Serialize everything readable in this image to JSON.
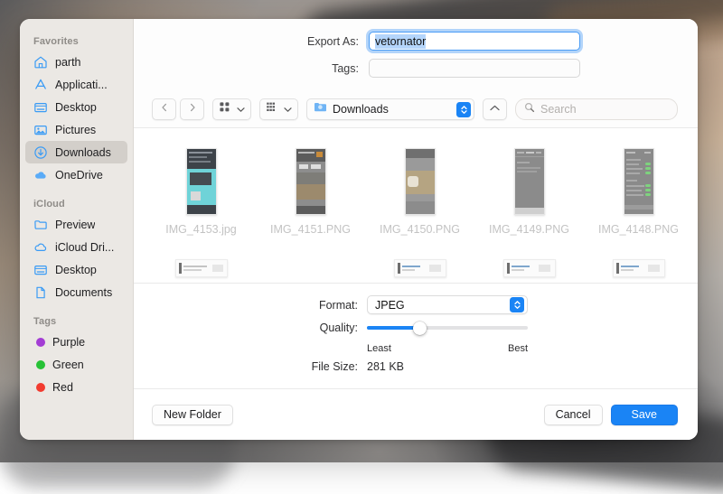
{
  "sidebar": {
    "sections": [
      {
        "title": "Favorites",
        "items": [
          {
            "label": "parth",
            "icon": "home-icon",
            "selected": false
          },
          {
            "label": "Applicati...",
            "icon": "applications-icon",
            "selected": false
          },
          {
            "label": "Desktop",
            "icon": "desktop-icon",
            "selected": false
          },
          {
            "label": "Pictures",
            "icon": "pictures-icon",
            "selected": false
          },
          {
            "label": "Downloads",
            "icon": "downloads-icon",
            "selected": true
          },
          {
            "label": "OneDrive",
            "icon": "cloud-icon",
            "selected": false
          }
        ]
      },
      {
        "title": "iCloud",
        "items": [
          {
            "label": "Preview",
            "icon": "folder-icon",
            "selected": false
          },
          {
            "label": "iCloud Dri...",
            "icon": "cloud-icon",
            "selected": false
          },
          {
            "label": "Desktop",
            "icon": "desktop-icon",
            "selected": false
          },
          {
            "label": "Documents",
            "icon": "document-icon",
            "selected": false
          }
        ]
      },
      {
        "title": "Tags",
        "items": [
          {
            "label": "Purple",
            "icon": "tag-dot-icon",
            "color": "#a33dd4",
            "selected": false
          },
          {
            "label": "Green",
            "icon": "tag-dot-icon",
            "color": "#27c236",
            "selected": false
          },
          {
            "label": "Red",
            "icon": "tag-dot-icon",
            "color": "#f23b2f",
            "selected": false
          }
        ]
      }
    ]
  },
  "header": {
    "export_as_label": "Export As:",
    "export_as_value": "vetornator",
    "tags_label": "Tags:",
    "tags_value": "",
    "tags_placeholder": ""
  },
  "toolbar": {
    "back_icon": "chevron-left-icon",
    "forward_icon": "chevron-right-icon",
    "icon_view_icon": "grid-view-icon",
    "list_view_icon": "list-view-icon",
    "path_label": "Downloads",
    "path_icon": "folder-downloads-icon",
    "stepper_icon": "updown-chevrons-icon",
    "collapse_icon": "chevron-up-icon",
    "search_icon": "search-icon",
    "search_placeholder": "Search",
    "search_value": ""
  },
  "files": {
    "row1": [
      {
        "name": "IMG_4153.jpg",
        "thumb": "teal"
      },
      {
        "name": "IMG_4151.PNG",
        "thumb": "photo"
      },
      {
        "name": "IMG_4150.PNG",
        "thumb": "photo2"
      },
      {
        "name": "IMG_4149.PNG",
        "thumb": "grey"
      },
      {
        "name": "IMG_4148.PNG",
        "thumb": "settings"
      }
    ],
    "row2_count": 5
  },
  "options": {
    "format_label": "Format:",
    "format_value": "JPEG",
    "quality_label": "Quality:",
    "quality_least": "Least",
    "quality_best": "Best",
    "quality_percent": 33,
    "filesize_label": "File Size:",
    "filesize_value": "281 KB"
  },
  "footer": {
    "new_folder_label": "New Folder",
    "cancel_label": "Cancel",
    "save_label": "Save"
  },
  "colors": {
    "accent": "#1a84f5",
    "selection": "#b4d5fb",
    "sidebar_bg": "#ebe8e4",
    "sidebar_selected": "#d3cfca"
  }
}
